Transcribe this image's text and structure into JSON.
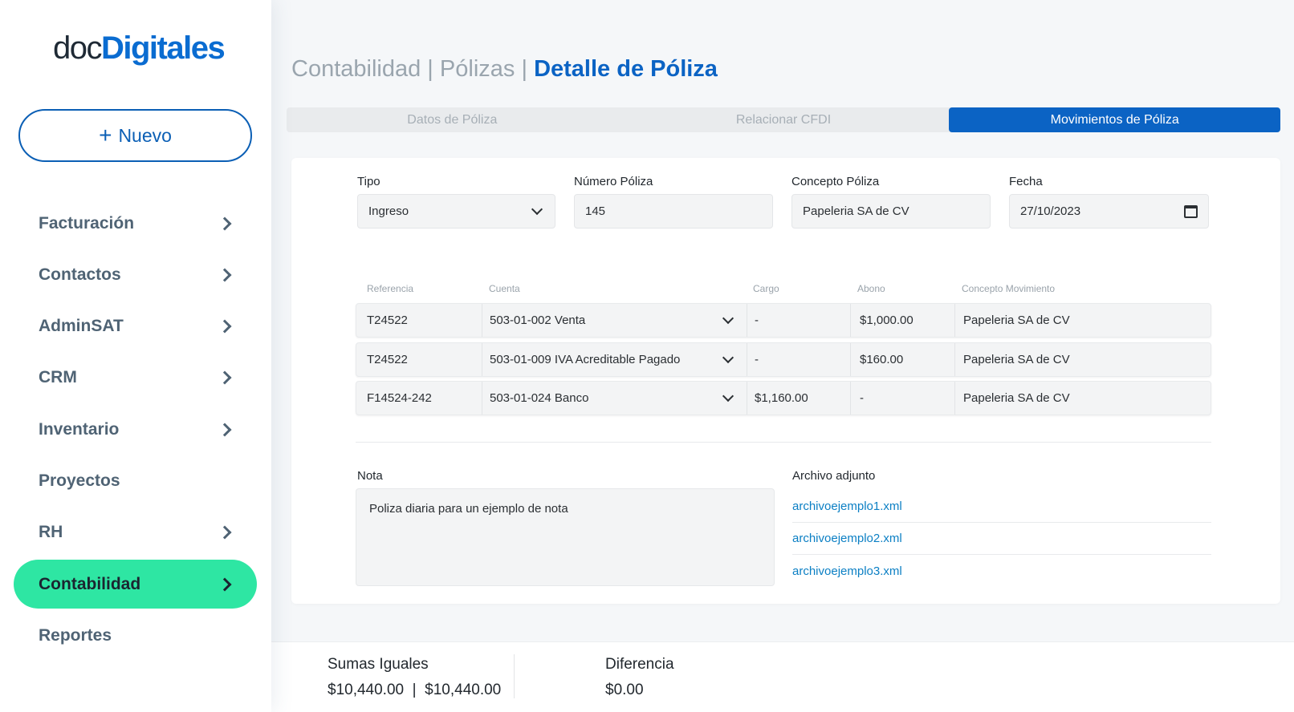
{
  "brand": {
    "part1": "doc",
    "part2": "Digitales"
  },
  "sidebar": {
    "new_button": {
      "icon": "plus-icon",
      "label": "Nuevo"
    },
    "items": [
      {
        "label": "Facturación",
        "has_chevron": true
      },
      {
        "label": "Contactos",
        "has_chevron": true
      },
      {
        "label": "AdminSAT",
        "has_chevron": true
      },
      {
        "label": "CRM",
        "has_chevron": true
      },
      {
        "label": "Inventario",
        "has_chevron": true
      },
      {
        "label": "Proyectos",
        "has_chevron": false
      },
      {
        "label": "RH",
        "has_chevron": true
      },
      {
        "label": "Contabilidad",
        "has_chevron": true,
        "active": true
      },
      {
        "label": "Reportes",
        "has_chevron": false
      }
    ],
    "active_color": "#2ee6a3"
  },
  "breadcrumb": {
    "part1": "Contabilidad",
    "part2": "Pólizas",
    "current": "Detalle de Póliza",
    "separator": "|"
  },
  "tabs": [
    {
      "label": "Datos de Póliza"
    },
    {
      "label": "Relacionar CFDI"
    },
    {
      "label": "Movimientos de Póliza",
      "active": true
    }
  ],
  "form": {
    "tipo": {
      "label": "Tipo",
      "value": "Ingreso"
    },
    "numero": {
      "label": "Número Póliza",
      "value": "145"
    },
    "concepto": {
      "label": "Concepto Póliza",
      "value": "Papeleria SA de CV"
    },
    "fecha": {
      "label": "Fecha",
      "value": "27/10/2023"
    }
  },
  "table": {
    "headers": [
      "Referencia",
      "Cuenta",
      "Cargo",
      "Abono",
      "Concepto Movimiento"
    ],
    "rows": [
      [
        "T24522",
        "503-01-002 Venta",
        "-",
        "$1,000.00",
        "Papeleria SA de CV"
      ],
      [
        "T24522",
        "503-01-009 IVA Acreditable Pagado",
        "-",
        "$160.00",
        "Papeleria SA de CV"
      ],
      [
        "F14524-242",
        "503-01-024 Banco",
        "$1,160.00",
        "-",
        "Papeleria SA de CV"
      ]
    ]
  },
  "nota": {
    "label": "Nota",
    "value": "Poliza diaria para un ejemplo de nota"
  },
  "archivo": {
    "label": "Archivo adjunto",
    "files": [
      "archivoejemplo1.xml",
      "archivoejemplo2.xml",
      "archivoejemplo3.xml"
    ]
  },
  "footer": {
    "sumas_label": "Sumas Iguales",
    "sumas_value": "$10,440.00  |  $10,440.00",
    "diferencia_label": "Diferencia",
    "diferencia_value": "$0.00"
  },
  "colors": {
    "primary": "#0b63c4",
    "accent": "#2ee6a3",
    "link": "#0b7fc4"
  }
}
